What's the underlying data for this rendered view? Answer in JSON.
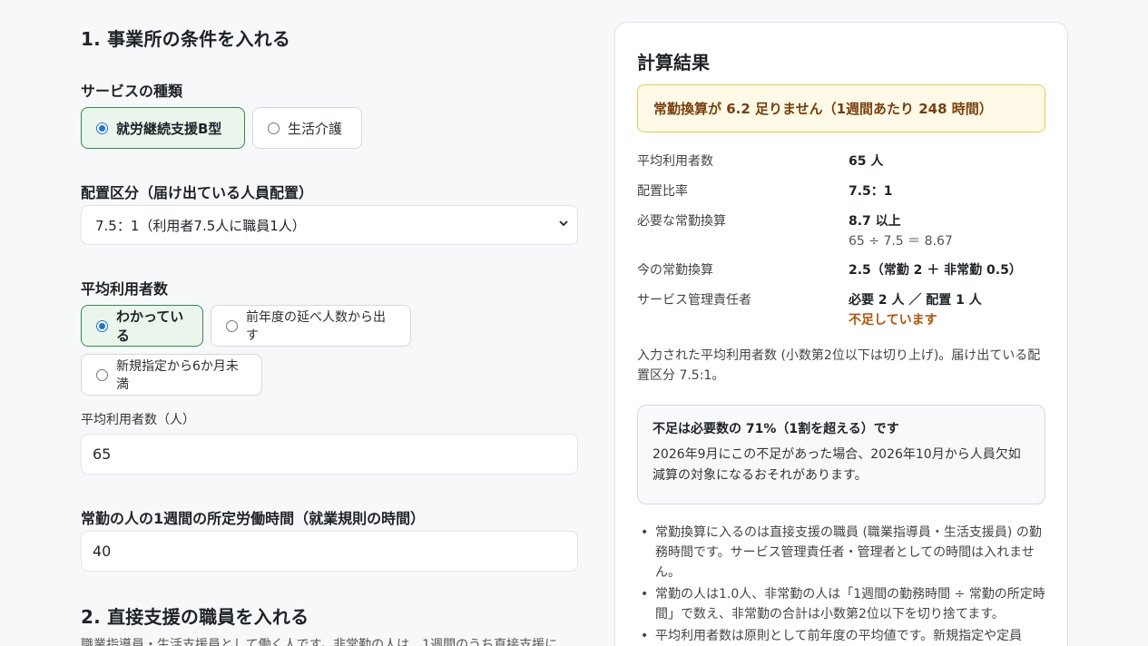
{
  "section1": {
    "heading": "1. 事業所の条件を入れる",
    "service_label": "サービスの種類",
    "service_options": [
      "就労継続支援B型",
      "生活介護"
    ],
    "placement_label": "配置区分（届け出ている人員配置）",
    "placement_value": "7.5：1（利用者7.5人に職員1人）",
    "avg_users_label": "平均利用者数",
    "avg_users_options": [
      "わかっている",
      "前年度の延べ人数から出す",
      "新規指定から6か月未満"
    ],
    "avg_users_input_label": "平均利用者数（人）",
    "avg_users_input_value": "65",
    "hours_label": "常勤の人の1週間の所定労働時間（就業規則の時間）",
    "hours_value": "40"
  },
  "section2": {
    "heading": "2. 直接支援の職員を入れる",
    "description": "職業指導員・生活支援員として働く人です。非常勤の人は、1週間のうち直接支援に"
  },
  "result": {
    "title": "計算結果",
    "alert": "常勤換算が 6.2 足りません（1週間あたり 248 時間）",
    "rows": {
      "avg_users_key": "平均利用者数",
      "avg_users_val": "65 人",
      "ratio_key": "配置比率",
      "ratio_val": "7.5：1",
      "required_key": "必要な常勤換算",
      "required_val": "8.7 以上",
      "required_sub": "65 ÷ 7.5 ＝ 8.67",
      "current_key": "今の常勤換算",
      "current_val": "2.5（常勤 2 ＋ 非常勤 0.5）",
      "manager_key": "サービス管理責任者",
      "manager_val": "必要 2 人 ／ 配置 1 人",
      "manager_status": "不足しています"
    },
    "note": "入力された平均利用者数 (小数第2位以下は切り上げ)。届け出ている配置区分 7.5:1。",
    "box_title": "不足は必要数の 71%（1割を超える）です",
    "box_body": "2026年9月にこの不足があった場合、2026年10月から人員欠如減算の対象になるおそれがあります。",
    "bullets": [
      "常勤換算に入るのは直接支援の職員 (職業指導員・生活支援員) の勤務時間です。サービス管理責任者・管理者としての時間は入れません。",
      "常勤の人は1.0人、非常勤の人は「1週間の勤務時間 ÷ 常勤の所定時間」で数え、非常勤の合計は小数第2位以下を切り捨てます。",
      "平均利用者数は原則として前年度の平均値です。新規指定や定員"
    ]
  }
}
